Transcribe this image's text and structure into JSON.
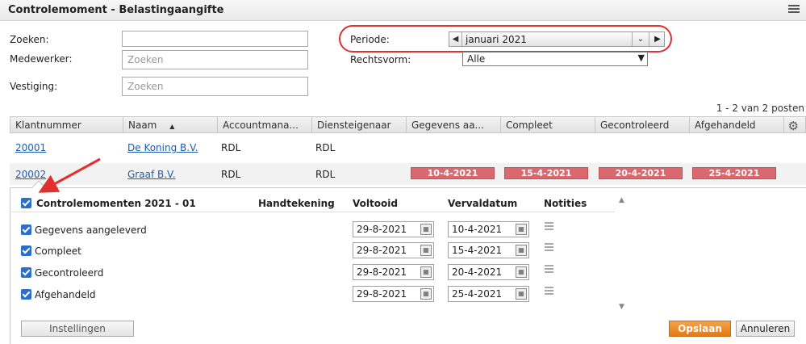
{
  "window": {
    "title": "Controlemoment - Belastingaangifte",
    "menu_icon": "list-icon"
  },
  "filters": {
    "zoeken_label": "Zoeken:",
    "zoeken_value": "",
    "medewerker_label": "Medewerker:",
    "medewerker_placeholder": "Zoeken",
    "vestiging_label": "Vestiging:",
    "vestiging_placeholder": "Zoeken",
    "periode_label": "Periode:",
    "periode_value": "januari 2021",
    "rechtsvorm_label": "Rechtsvorm:",
    "rechtsvorm_value": "Alle"
  },
  "pager": "1 - 2 van 2 posten",
  "grid": {
    "columns": [
      "Klantnummer",
      "Naam",
      "Accountmana...",
      "Diensteigenaar",
      "Gegevens aa...",
      "Compleet",
      "Gecontroleerd",
      "Afgehandeld"
    ],
    "sort_indicator": "▲",
    "rows": [
      {
        "klantnummer": "20001",
        "naam": "De Koning B.V.",
        "accountmanager": "RDL",
        "diensteigenaar": "RDL"
      },
      {
        "klantnummer": "20002",
        "naam": "Graaf B.V.",
        "accountmanager": "RDL",
        "diensteigenaar": "RDL",
        "gegevens": "10-4-2021",
        "compleet": "15-4-2021",
        "gecontroleerd": "20-4-2021",
        "afgehandeld": "25-4-2021"
      }
    ],
    "badge_color": "#d9696e"
  },
  "detail": {
    "title": "Controlemomenten 2021 - 01",
    "col_handtekening": "Handtekening",
    "col_voltooid": "Voltooid",
    "col_vervaldatum": "Vervaldatum",
    "col_notities": "Notities",
    "items": [
      {
        "label": "Gegevens aangeleverd",
        "voltooid": "29-8-2021",
        "vervaldatum": "10-4-2021"
      },
      {
        "label": "Compleet",
        "voltooid": "29-8-2021",
        "vervaldatum": "15-4-2021"
      },
      {
        "label": "Gecontroleerd",
        "voltooid": "29-8-2021",
        "vervaldatum": "20-4-2021"
      },
      {
        "label": "Afgehandeld",
        "voltooid": "29-8-2021",
        "vervaldatum": "25-4-2021"
      }
    ]
  },
  "buttons": {
    "instellingen": "Instellingen",
    "opslaan": "Opslaan",
    "annuleren": "Annuleren"
  },
  "colors": {
    "accent_orange": "#e57a12",
    "link_blue": "#1c5dac",
    "annotation_red": "#e03030"
  }
}
